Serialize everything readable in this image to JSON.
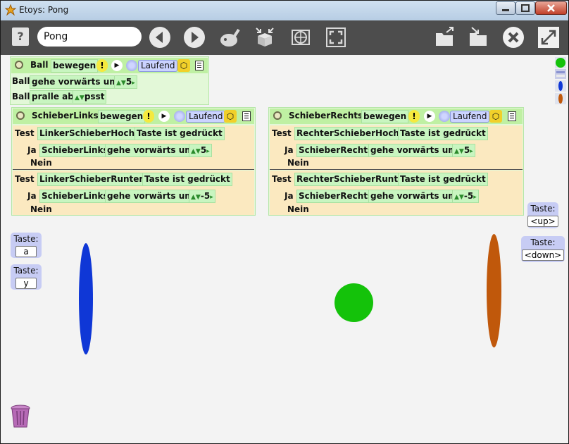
{
  "window": {
    "title": "Etoys: Pong"
  },
  "toolbar": {
    "project_name": "Pong",
    "help": "?"
  },
  "ball_script": {
    "object": "Ball",
    "name": "bewegen",
    "status": "Laufend",
    "line1": {
      "object": "Ball",
      "command": "gehe vorwärts um",
      "value": "5"
    },
    "line2": {
      "object": "Ball",
      "command": "pralle ab",
      "value": "psst"
    }
  },
  "left_script": {
    "object": "SchieberLinks",
    "name": "bewegen",
    "status": "Laufend",
    "tests": [
      {
        "test": "Test",
        "key": "LinkerSchieberHochs",
        "cond": "Taste ist gedrückt",
        "yes": "Ja",
        "obj": "SchieberLinks",
        "cmd": "gehe vorwärts um",
        "value": "5",
        "no": "Nein"
      },
      {
        "test": "Test",
        "key": "LinkerSchieberRunters",
        "cond": "Taste ist gedrückt",
        "yes": "Ja",
        "obj": "SchieberLinks",
        "cmd": "gehe vorwärts um",
        "value": "-5",
        "no": "Nein"
      }
    ]
  },
  "right_script": {
    "object": "SchieberRechts",
    "name": "bewegen",
    "status": "Laufend",
    "tests": [
      {
        "test": "Test",
        "key": "RechterSchieberHochs",
        "cond": "Taste ist gedrückt",
        "yes": "Ja",
        "obj": "SchieberRechts",
        "cmd": "gehe vorwärts um",
        "value": "5",
        "no": "Nein"
      },
      {
        "test": "Test",
        "key": "RechterSchieberRunters",
        "cond": "Taste ist gedrückt",
        "yes": "Ja",
        "obj": "SchieberRechts",
        "cmd": "gehe vorwärts um",
        "value": "-5",
        "no": "Nein"
      }
    ]
  },
  "keys": [
    {
      "label": "Taste:",
      "key": "a"
    },
    {
      "label": "Taste:",
      "key": "y"
    },
    {
      "label": "Taste:",
      "key": "<up>"
    },
    {
      "label": "Taste:",
      "key": "<down>"
    }
  ],
  "colors": {
    "ball": "#14c20a",
    "left_paddle": "#0f37d6",
    "right_paddle": "#c0580b",
    "toolbar": "#4d4d4d",
    "script_header": "#bff0a3",
    "test_body": "#fbe9c0"
  }
}
